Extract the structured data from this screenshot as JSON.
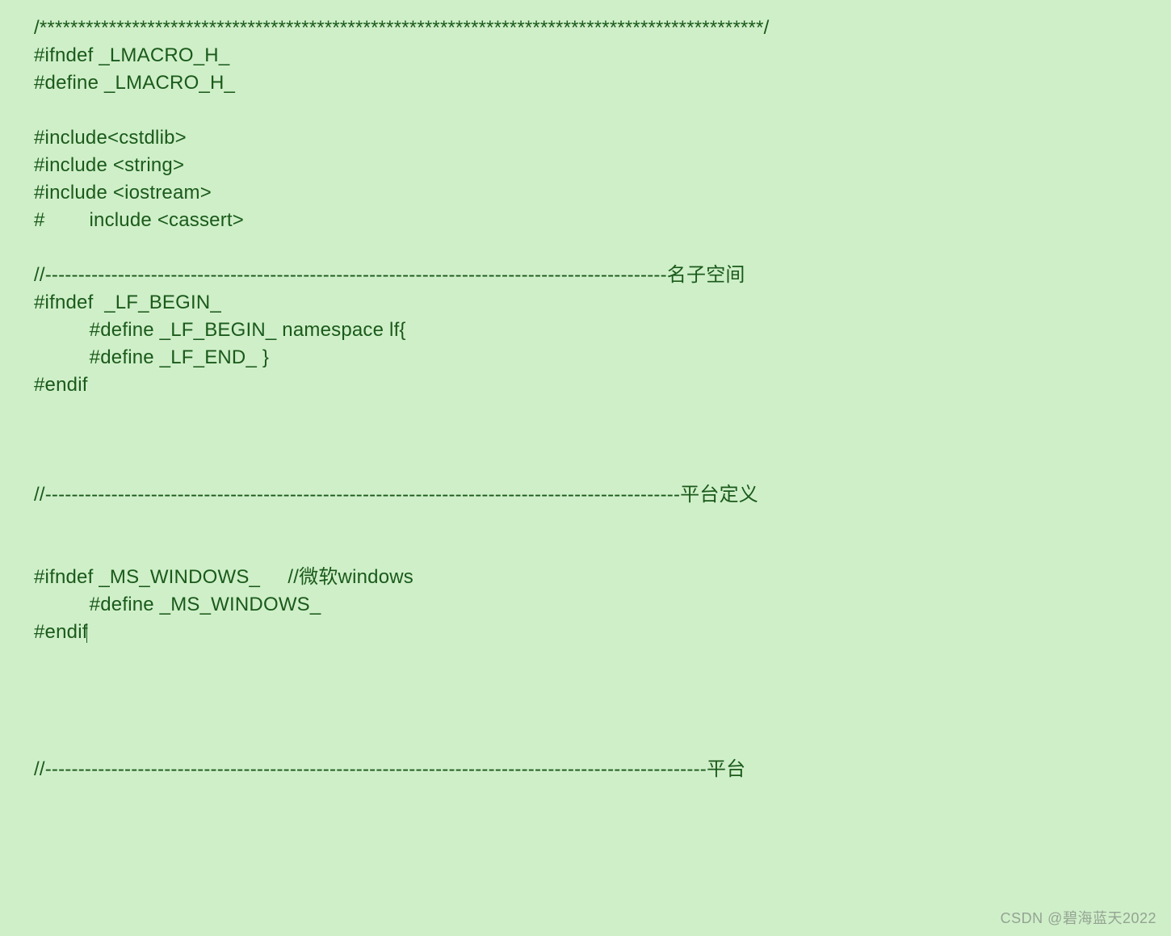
{
  "code": {
    "lines": [
      "/**********************************************************************************************/",
      "#ifndef _LMACRO_H_",
      "#define _LMACRO_H_",
      "",
      "#include<cstdlib>",
      "#include <string>",
      "#include <iostream>",
      "#        include <cassert>",
      "",
      "//----------------------------------------------------------------------------------------------名子空间",
      "#ifndef  _LF_BEGIN_",
      "          #define _LF_BEGIN_ namespace lf{",
      "          #define _LF_END_ }",
      "#endif",
      "",
      "",
      "",
      "//------------------------------------------------------------------------------------------------平台定义",
      "",
      "",
      "#ifndef _MS_WINDOWS_     //微软windows",
      "          #define _MS_WINDOWS_",
      "#endif",
      "",
      "",
      "",
      "",
      "//----------------------------------------------------------------------------------------------------平台"
    ],
    "cursor_line_index": 22
  },
  "watermark": "CSDN @碧海蓝天2022"
}
